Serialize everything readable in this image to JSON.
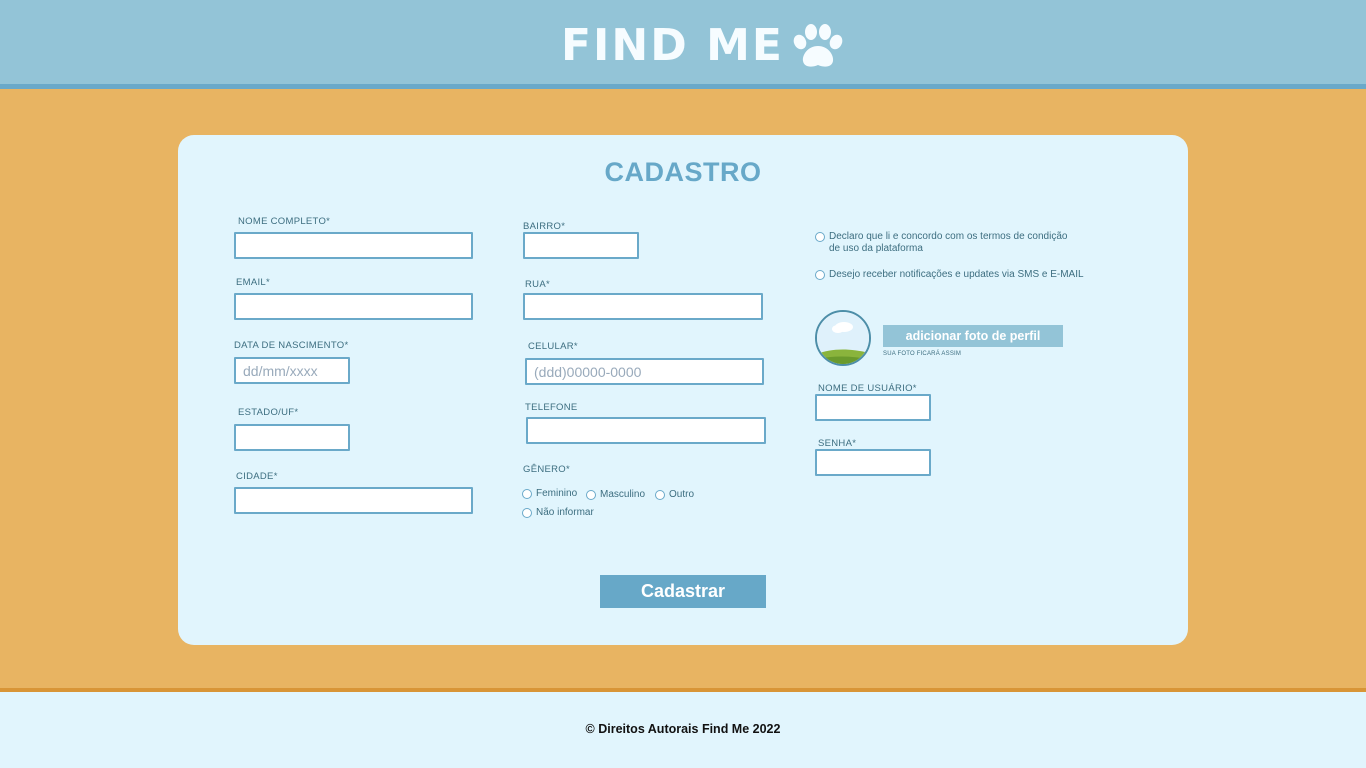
{
  "header": {
    "logo_text": "FIND ME",
    "logo_icon": "paw-icon"
  },
  "form": {
    "title": "CADASTRO",
    "col1": {
      "nome_label": "NOME COMPLETO*",
      "email_label": "EMAIL*",
      "nascimento_label": "DATA DE NASCIMENTO*",
      "nascimento_placeholder": "dd/mm/xxxx",
      "estado_label": "ESTADO/UF*",
      "cidade_label": "CIDADE*"
    },
    "col2": {
      "bairro_label": "BAIRRO*",
      "rua_label": "RUA*",
      "celular_label": "CELULAR*",
      "celular_placeholder": "(ddd)00000-0000",
      "telefone_label": "TELEFONE",
      "genero_label": "GÊNERO*",
      "genero_options": [
        "Feminino",
        "Masculino",
        "Outro",
        "Não informar"
      ]
    },
    "col3": {
      "terms_line1": "Declaro que li e concordo com os termos de condição",
      "terms_line2": "de uso da plataforma",
      "notifications": "Desejo receber notificações e updates via SMS e E-MAIL",
      "photo_button": "adicionar foto de perfil",
      "photo_note": "SUA FOTO FICARÁ ASSIM",
      "usuario_label": "NOME DE USUÁRIO*",
      "senha_label": "SENHA*"
    },
    "submit_label": "Cadastrar"
  },
  "footer": {
    "copyright": "© Direitos Autorais Find Me 2022"
  },
  "colors": {
    "header": "#93c4d7",
    "body": "#e8b462",
    "card": "#e1f5fd",
    "accent": "#67a8c8",
    "footer_border": "#d89537"
  }
}
